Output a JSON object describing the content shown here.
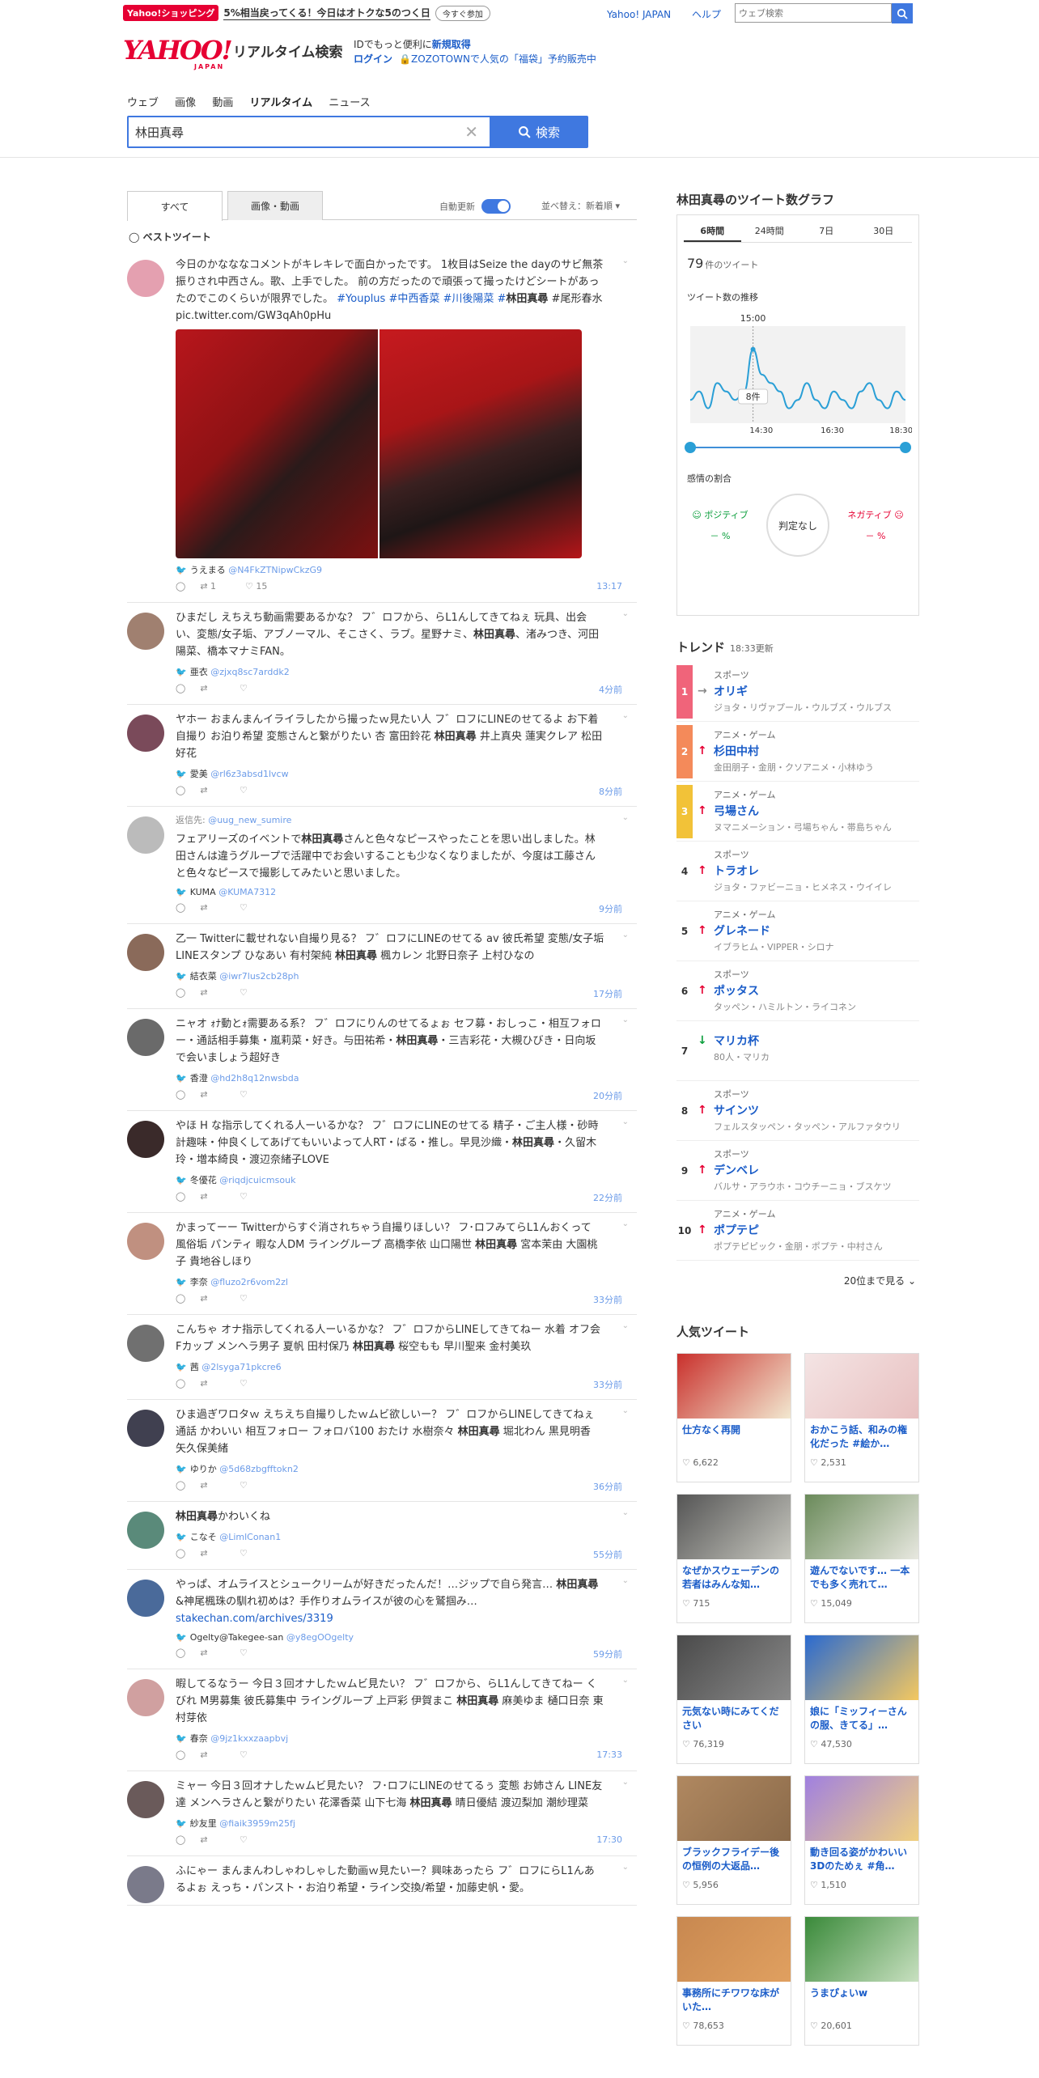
{
  "promo": {
    "tag": "Yahoo!ショッピング",
    "text": "5%相当戻ってくる！今日はオトクな5のつく日",
    "pill": "今すぐ参加"
  },
  "toplinks": [
    "Yahoo! JAPAN",
    "ヘルプ"
  ],
  "top_search_placeholder": "ウェブ検索",
  "logo": {
    "main": "YAHOO!",
    "sub": "JAPAN",
    "service": "リアルタイム検索"
  },
  "login": {
    "line1_pre": "IDでもっと便利に",
    "line1_link": "新規取得",
    "login": "ログイン",
    "notice": "ZOZOTOWNで人気の「福袋」予約販売中"
  },
  "nav": [
    "ウェブ",
    "画像",
    "動画",
    "リアルタイム",
    "ニュース"
  ],
  "search": {
    "value": "林田真尋",
    "button": "検索"
  },
  "tabs": {
    "all": "すべて",
    "media": "画像・動画",
    "auto": "自動更新",
    "sort": "並べ替え：新着順"
  },
  "best_label": "ベストツイート",
  "tweets": [
    {
      "pre": "今日のかなななコメントがキレキレで面白かったです。 1枚目はSeize the dayのサビ無茶振りされ中西さん。歌、上手でした。 前の方だったので頑張って撮ったけどシートがあったのでこのくらいが限界でした。 ",
      "tags": "#Youplus #中西香菜 #川後陽菜 #",
      "kw": "林田真尋",
      "post": " #尾形春水 pic.twitter.com/GW3qAh0pHu",
      "user": "うえまる",
      "handle": "@N4FkZTNipwCkzG9",
      "rt": "1",
      "like": "15",
      "time": "13:17",
      "color": "#e4a0b0"
    },
    {
      "pre": "ひまだし えちえち動画需要あるかな？ フ゛ロフから、らL1んしてきてねぇ 玩具、出会い、変態/女子垢、アブノーマル、そこさく、ラブ。星野ナミ、",
      "kw": "林田真尋",
      "post": "、渚みつき、河田陽菜、橋本マナミFAN。",
      "user": "亜衣",
      "handle": "@zjxq8sc7arddk2",
      "time": "4分前",
      "color": "#a08070"
    },
    {
      "pre": "ヤホー おまんまんイライラしたから撮ったｗ見たい人 フ゛ロフにLINEのせてるよ お下着 自撮り お泊り希望 変態さんと繋がりたい 杏 富田鈴花 ",
      "kw": "林田真尋",
      "post": " 井上真央 蓮実クレア 松田好花",
      "user": "愛美",
      "handle": "@rl6z3absd1lvcw",
      "time": "8分前",
      "color": "#7a4a5a"
    },
    {
      "reply": "返信先: ",
      "reply_to": "@uug_new_sumire",
      "pre": "フェアリーズのイベントで",
      "kw": "林田真尋",
      "post": "さんと色々なピースやったことを思い出しました。林田さんは違うグループで活躍中でお会いすることも少なくなりましたが、今度は工藤さんと色々なピースで撮影してみたいと思いました。",
      "user": "KUMA",
      "handle": "@KUMA7312",
      "time": "9分前",
      "color": "#bbbbbb"
    },
    {
      "pre": "乙一 Twitterに載せれない自撮り見る？ フ゛ロフにLINEのせてる av 彼氏希望 変態/女子垢 LINEスタンプ ひなあい 有村架純 ",
      "kw": "林田真尋",
      "post": " 楓カレン 北野日奈子 上村ひなの",
      "user": "結衣菜",
      "handle": "@iwr7lus2cb28ph",
      "time": "17分前",
      "color": "#8a6a5a"
    },
    {
      "pre": "ニャオ ｫﾅ動とｫ需要ある系？ フ゛ロフにりんのせてるょぉ セフ募・おしっこ・相互フォロー・通話相手募集・嵐莉菜・好き。与田祐希・",
      "kw": "林田真尋",
      "post": "・三吉彩花・大槻ひびき・日向坂で会いましょう超好き",
      "user": "香澄",
      "handle": "@hd2h8q12nwsbda",
      "time": "20分前",
      "color": "#6a6a6a"
    },
    {
      "pre": "やほ H な指示してくれる人ーいるかな？ フ゛ロフにLINEのせてる 精子・ご主人様・砂時計趣味・仲良くしてあげてもいいよって人RT・ばる・推し。早見沙織・",
      "kw": "林田真尋",
      "post": "・久留木玲・増本綺良・渡辺奈緒子LOVE",
      "user": "冬優花",
      "handle": "@riqdjcuicmsouk",
      "time": "22分前",
      "color": "#3a2a2a"
    },
    {
      "pre": "かまってーー Twitterからすぐ消されちゃう自撮りほしい？ フ･ロフみてらL1んおくって 風俗垢 パンティ 暇な人DM ライングループ 高橋李依 山口陽世 ",
      "kw": "林田真尋",
      "post": " 宮本茉由 大園桃子 貴地谷しほり",
      "user": "李奈",
      "handle": "@fluzo2r6vom2zl",
      "time": "33分前",
      "color": "#c09080"
    },
    {
      "pre": "こんちゃ オナ指示してくれる人ーいるかな？ フ゛ロフからLINEしてきてねー 水着 オフ会 Fカップ メンヘラ男子 夏帆 田村保乃 ",
      "kw": "林田真尋",
      "post": " 桜空もも 早川聖来 金村美玖",
      "user": "茜",
      "handle": "@2lsyga71pkcre6",
      "time": "33分前",
      "color": "#707070"
    },
    {
      "pre": "ひま過ぎワロタｗ えちえち自撮りしたｗムビ欲しいー？ フ゛ロフからLINEしてきてねぇ 通話 かわいい 相互フォロー フォロバ100 おたけ 水樹奈々 ",
      "kw": "林田真尋",
      "post": " 堀北わん 黒見明香 矢久保美緒",
      "user": "ゆりか",
      "handle": "@5d68zbgfftokn2",
      "time": "36分前",
      "color": "#404050"
    },
    {
      "pre": "",
      "kw": "林田真尋",
      "post": "かわいくね",
      "user": "こなそ",
      "handle": "@LimlConan1",
      "time": "55分前",
      "color": "#5a8a7a"
    },
    {
      "pre": "やっぱ、オムライスとシュークリームが好きだったんだ！…ジップで自ら発言… ",
      "kw": "林田真尋",
      "post": "&神尾楓珠の馴れ初めは？手作りオムライスが彼の心を鷲掴み…",
      "link": "stakechan.com/archives/3319",
      "user": "Ogelty@Takegee-san",
      "handle": "@y8egOOgelty",
      "time": "59分前",
      "color": "#4a6a9a"
    },
    {
      "pre": "暇してるなうー 今日３回オナしたｗムビ見たい？ フ゛ロフから、らL1んしてきてねー くびれ M男募集 彼氏募集中 ライングループ 上戸彩 伊賀まこ ",
      "kw": "林田真尋",
      "post": " 麻美ゆま 樋口日奈 東村芽依",
      "user": "春奈",
      "handle": "@9jz1kxxzaapbvj",
      "time": "17:33",
      "color": "#d0a0a0"
    },
    {
      "pre": "ミャー 今日３回オナしたｗムビ見たい？ フ･ロフにLINEのせてるぅ 変態 お姉さん LINE友達 メンヘラさんと繋がりたい 花澤香菜 山下七海 ",
      "kw": "林田真尋",
      "post": " 晴日優結 渡辺梨加 潮紗理菜",
      "user": "紗友里",
      "handle": "@fiaik3959m25fj",
      "time": "17:30",
      "color": "#6a5a5a"
    },
    {
      "pre": "ふにゃー まんまんわしゃわしゃした動画ｗ見たいー？興味あったら フ゛ロフにらL1んあるよぉ えっち・パンスト・お泊り希望・ライン交換/希望・加藤史帆・愛。",
      "kw": "",
      "post": "",
      "user": "",
      "handle": "",
      "time": "",
      "color": "#7a7a8a"
    }
  ],
  "graph": {
    "title": "林田真尋のツイート数グラフ",
    "tabs": [
      "6時間",
      "24時間",
      "7日",
      "30日"
    ],
    "count": "79",
    "count_unit": "件のツイート",
    "trend_label": "ツイート数の推移",
    "peak_time": "15:00",
    "peak_value": "8件",
    "axis": [
      "14:30",
      "16:30",
      "18:30"
    ],
    "emotion": "感情の割合",
    "positive": "ポジティブ",
    "negative": "ネガティブ",
    "pos_val": "－",
    "neg_val": "－",
    "pct": "%",
    "judge": "判定なし"
  },
  "chart_data": {
    "type": "line",
    "x_labels": [
      "14:30",
      "16:30",
      "18:30"
    ],
    "values": [
      2,
      3,
      1,
      4,
      3,
      2,
      3,
      8,
      5,
      4,
      3,
      1,
      2,
      4,
      2,
      1,
      3,
      2,
      1,
      3,
      4,
      2,
      1,
      3,
      2
    ],
    "peak": {
      "x": "15:00",
      "y": 8
    },
    "ylim": [
      0,
      10
    ]
  },
  "trend": {
    "title": "トレンド",
    "updated": "18:33更新",
    "more": "20位まで見る",
    "items": [
      {
        "rank": "1",
        "cat": "スポーツ",
        "kw": "オリギ",
        "sub": "ジョタ・リヴァプール・ウルブズ・ウルブス",
        "dir": "right"
      },
      {
        "rank": "2",
        "cat": "アニメ・ゲーム",
        "kw": "杉田中村",
        "sub": "金田朋子・金朋・クソアニメ・小林ゆう",
        "dir": "up"
      },
      {
        "rank": "3",
        "cat": "アニメ・ゲーム",
        "kw": "弓場さん",
        "sub": "ヌマニメーション・弓場ちゃん・帯島ちゃん",
        "dir": "up"
      },
      {
        "rank": "4",
        "cat": "スポーツ",
        "kw": "トラオレ",
        "sub": "ジョタ・ファビーニョ・ヒメネス・ウイイレ",
        "dir": "up"
      },
      {
        "rank": "5",
        "cat": "アニメ・ゲーム",
        "kw": "グレネード",
        "sub": "イブラヒム・VIPPER・シロナ",
        "dir": "up"
      },
      {
        "rank": "6",
        "cat": "スポーツ",
        "kw": "ポッタス",
        "sub": "タッペン・ハミルトン・ライコネン",
        "dir": "up"
      },
      {
        "rank": "7",
        "cat": "",
        "kw": "マリカ杯",
        "sub": "80人・マリカ",
        "dir": "down"
      },
      {
        "rank": "8",
        "cat": "スポーツ",
        "kw": "サインツ",
        "sub": "フェルスタッペン・タッペン・アルファタウリ",
        "dir": "up"
      },
      {
        "rank": "9",
        "cat": "スポーツ",
        "kw": "デンベレ",
        "sub": "バルサ・アラウホ・コウチーニョ・ブスケツ",
        "dir": "up"
      },
      {
        "rank": "10",
        "cat": "アニメ・ゲーム",
        "kw": "ポプテピ",
        "sub": "ポプテピピック・金朋・ポプテ・中村さん",
        "dir": "up"
      }
    ]
  },
  "popular": {
    "title": "人気ツイート",
    "items": [
      {
        "t": "仕方なく再開",
        "likes": "6,622",
        "c1": "#c9302c",
        "c2": "#f2e8d0"
      },
      {
        "t": "おかこう話、和みの権化だった #絵か…",
        "likes": "2,531",
        "c1": "#f4e4e4",
        "c2": "#e8c0c0"
      },
      {
        "t": "なぜかスウェーデンの若者はみんな知…",
        "likes": "715",
        "c1": "#555",
        "c2": "#c8c8c0"
      },
      {
        "t": "遊んでないです… 一本でも多く売れて…",
        "likes": "15,049",
        "c1": "#6a8a5a",
        "c2": "#e8e8e0"
      },
      {
        "t": "元気ない時にみてください",
        "likes": "76,319",
        "c1": "#4a4a4a",
        "c2": "#8a8a8a"
      },
      {
        "t": "娘に「ミッフィーさんの服、きてる」…",
        "likes": "47,530",
        "c1": "#2a6ad0",
        "c2": "#f4c860"
      },
      {
        "t": "ブラックフライデー後の恒例の大返品…",
        "likes": "5,956",
        "c1": "#b08860",
        "c2": "#8a6a4a"
      },
      {
        "t": "動き回る姿がかわいい3Dのためぇ #角…",
        "likes": "1,510",
        "c1": "#a080e0",
        "c2": "#f0d080"
      },
      {
        "t": "事務所にチワワな床がいた…",
        "likes": "78,653",
        "c1": "#c88850",
        "c2": "#e0a060"
      },
      {
        "t": "うまぴょいw",
        "likes": "20,601",
        "c1": "#3a8a3a",
        "c2": "#c8e0c0"
      }
    ]
  }
}
